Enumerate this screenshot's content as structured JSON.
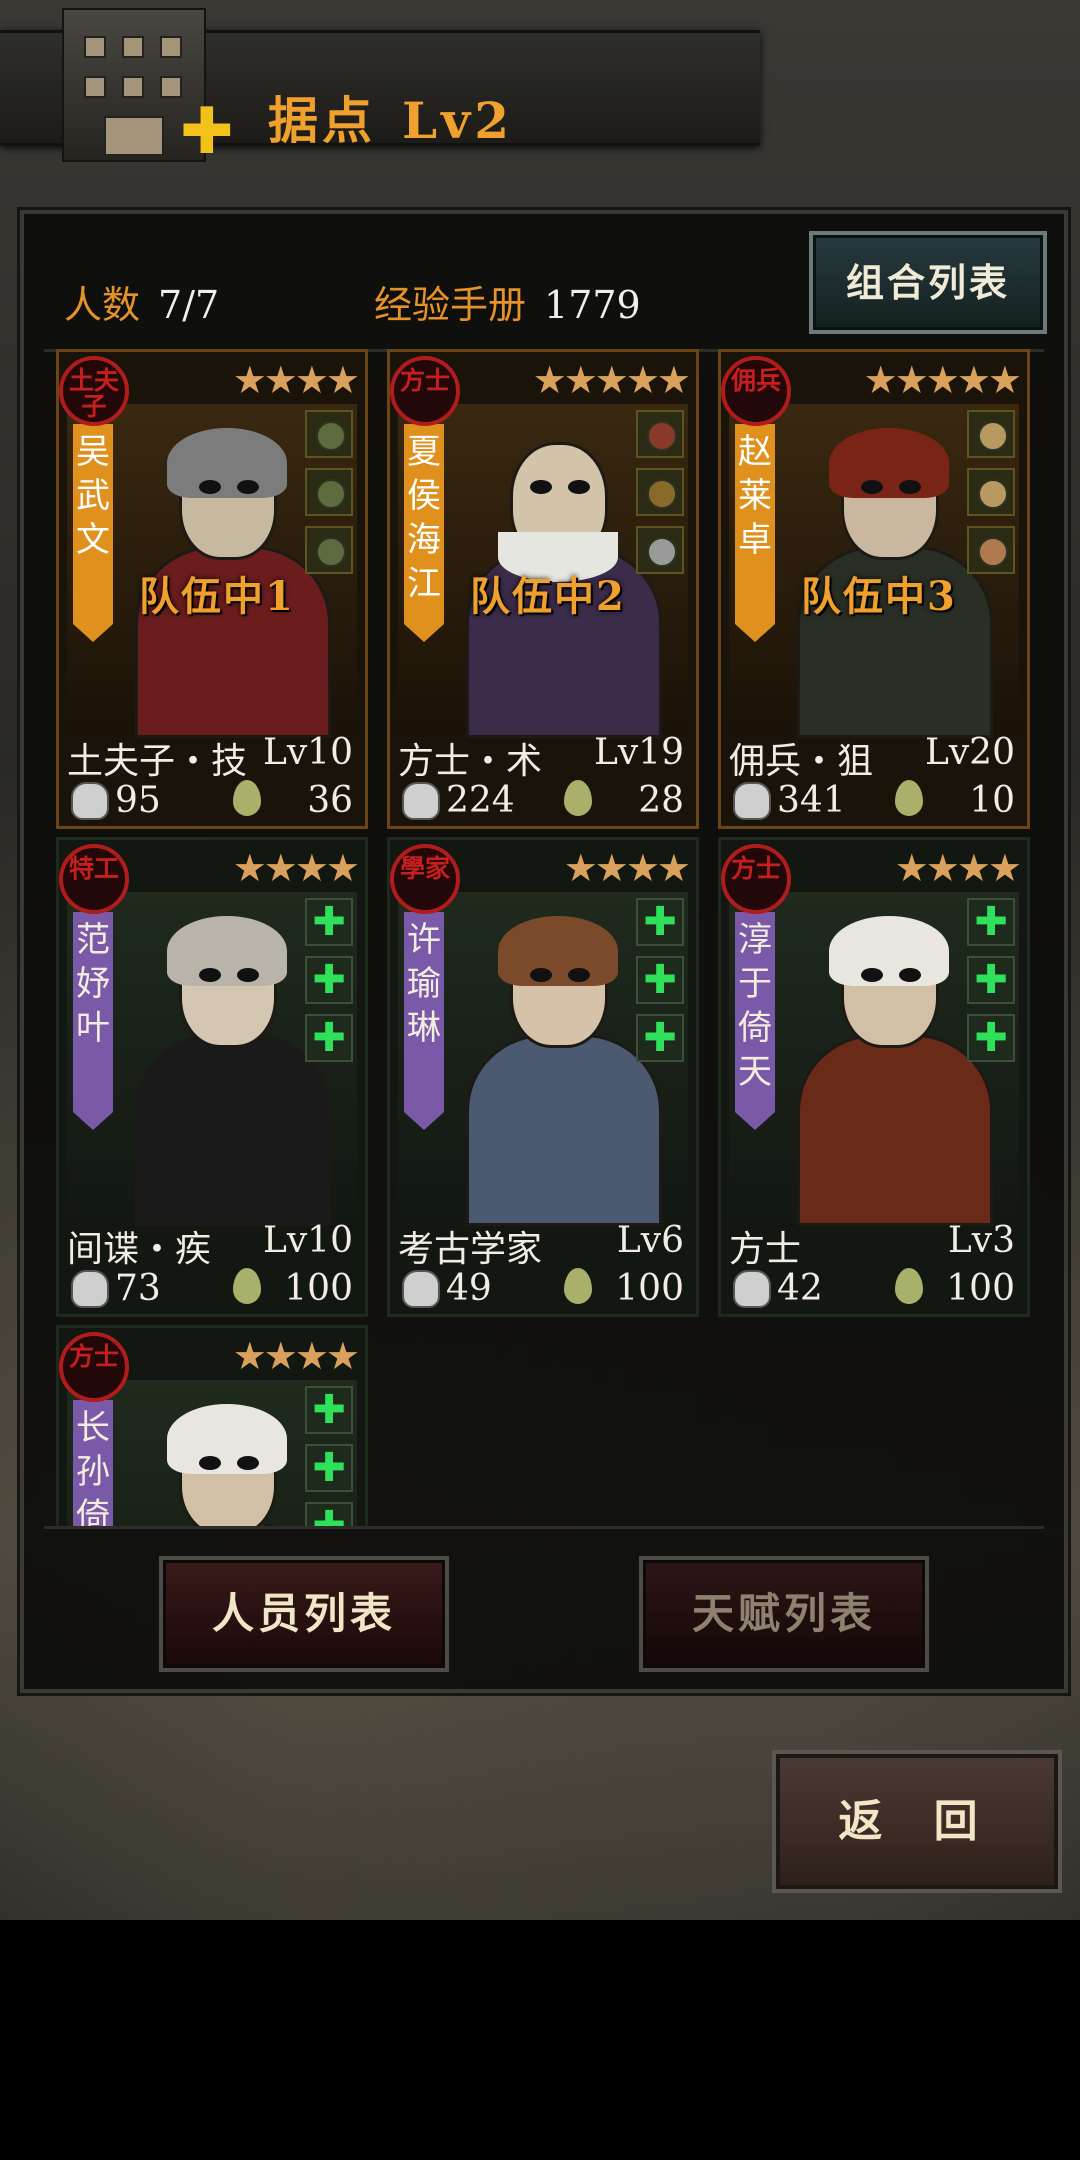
{
  "header": {
    "title": "据点",
    "level": "Lv2"
  },
  "stats": {
    "count_label": "人数",
    "count_value": "7/7",
    "exp_label": "经验手册",
    "exp_value": "1779",
    "combo_button": "组合列表"
  },
  "characters": [
    {
      "seal": "土夫子",
      "name": "吴武文",
      "stars": "★★★★",
      "role": "土夫子・技",
      "level": "Lv10",
      "power": "95",
      "stamina": "36",
      "team": "队伍中1",
      "in_team": true,
      "equip": [
        "gem",
        "gem",
        "gem"
      ]
    },
    {
      "seal": "方士",
      "name": "夏侯海江",
      "stars": "★★★★★",
      "role": "方士・术",
      "level": "Lv19",
      "power": "224",
      "stamina": "28",
      "team": "队伍中2",
      "in_team": true,
      "equip": [
        "gem",
        "gem",
        "gem"
      ]
    },
    {
      "seal": "佣兵",
      "name": "赵莱卓",
      "stars": "★★★★★",
      "role": "佣兵・狙",
      "level": "Lv20",
      "power": "341",
      "stamina": "10",
      "team": "队伍中3",
      "in_team": true,
      "equip": [
        "purple",
        "purple",
        "purple"
      ]
    },
    {
      "seal": "特工",
      "name": "范妤叶",
      "stars": "★★★★",
      "role": "间谍・疾",
      "level": "Lv10",
      "power": "73",
      "stamina": "100",
      "team": "",
      "in_team": false,
      "equip": [
        "plus",
        "plus",
        "plus"
      ]
    },
    {
      "seal": "學家",
      "name": "许瑜琳",
      "stars": "★★★★",
      "role": "考古学家",
      "level": "Lv6",
      "power": "49",
      "stamina": "100",
      "team": "",
      "in_team": false,
      "equip": [
        "plus",
        "plus",
        "plus"
      ]
    },
    {
      "seal": "方士",
      "name": "淳于倚天",
      "stars": "★★★★",
      "role": "方士",
      "level": "Lv3",
      "power": "42",
      "stamina": "100",
      "team": "",
      "in_team": false,
      "equip": [
        "plus",
        "plus",
        "plus"
      ]
    },
    {
      "seal": "方士",
      "name": "长孙倚",
      "stars": "★★★★",
      "role": "",
      "level": "",
      "power": "",
      "stamina": "",
      "team": "",
      "in_team": false,
      "equip": [
        "plus",
        "plus",
        "plus"
      ]
    }
  ],
  "tabs": {
    "personnel": "人员列表",
    "talent": "天赋列表"
  },
  "back_button": "返 回",
  "colors": {
    "accent": "#f0a02c",
    "name_banner": "#7a59a8",
    "team_banner": "#e0901c",
    "plus_green": "#2fe05a"
  }
}
